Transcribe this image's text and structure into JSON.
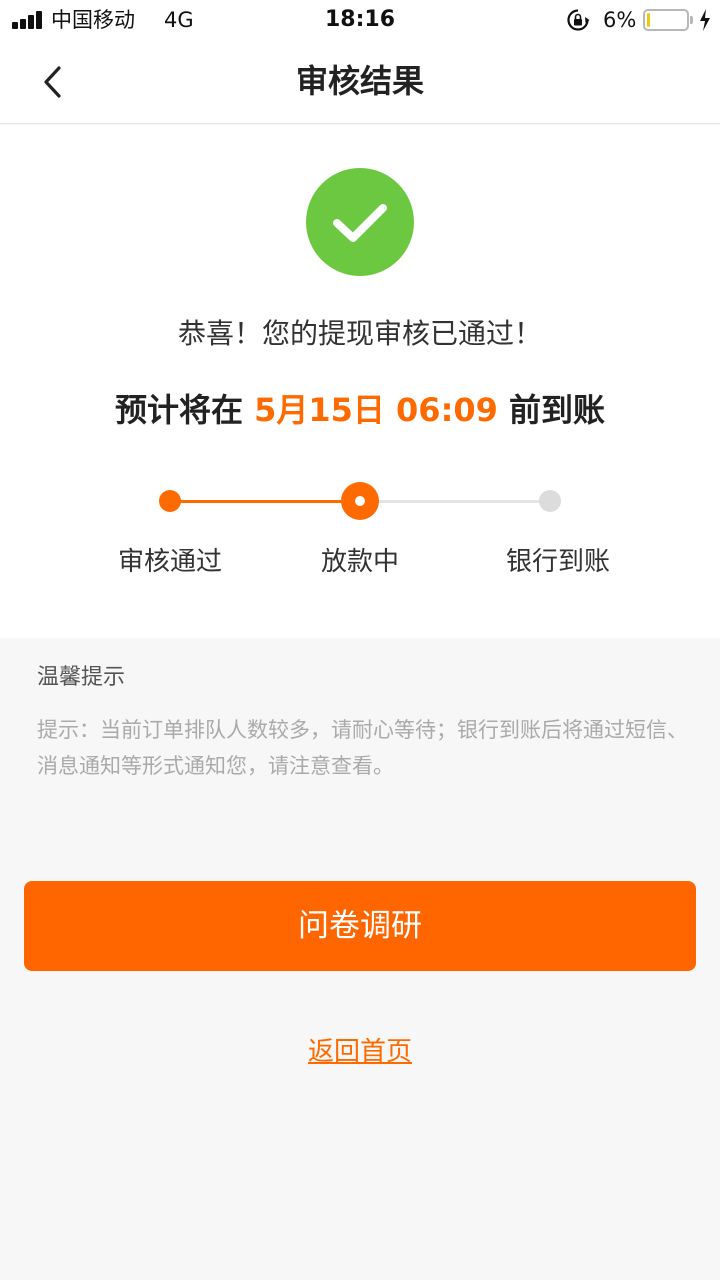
{
  "status_bar": {
    "carrier": "中国移动",
    "network": "4G",
    "time": "18:16",
    "battery_percent": "6%",
    "battery_level": 0.06,
    "icons": [
      "signal-icon",
      "lock-rotation-icon",
      "battery-icon",
      "charging-bolt-icon"
    ]
  },
  "nav": {
    "title": "审核结果",
    "back_icon": "chevron-left-icon"
  },
  "result": {
    "icon": "check-circle-icon",
    "icon_color": "#6cc840",
    "message": "恭喜！您的提现审核已通过！",
    "eta_prefix": "预计将在 ",
    "eta_date": "5月15日 06:09",
    "eta_suffix": " 前到账"
  },
  "progress": {
    "steps": [
      {
        "label": "审核通过",
        "state": "done"
      },
      {
        "label": "放款中",
        "state": "current"
      },
      {
        "label": "银行到账",
        "state": "pending"
      }
    ]
  },
  "tips": {
    "title": "温馨提示",
    "body": "提示：当前订单排队人数较多，请耐心等待；银行到账后将通过短信、消息通知等形式通知您，请注意查看。"
  },
  "actions": {
    "survey_label": "问卷调研",
    "home_label": "返回首页"
  },
  "colors": {
    "accent": "#ff6600",
    "success": "#6cc840",
    "background": "#f7f7f7"
  }
}
